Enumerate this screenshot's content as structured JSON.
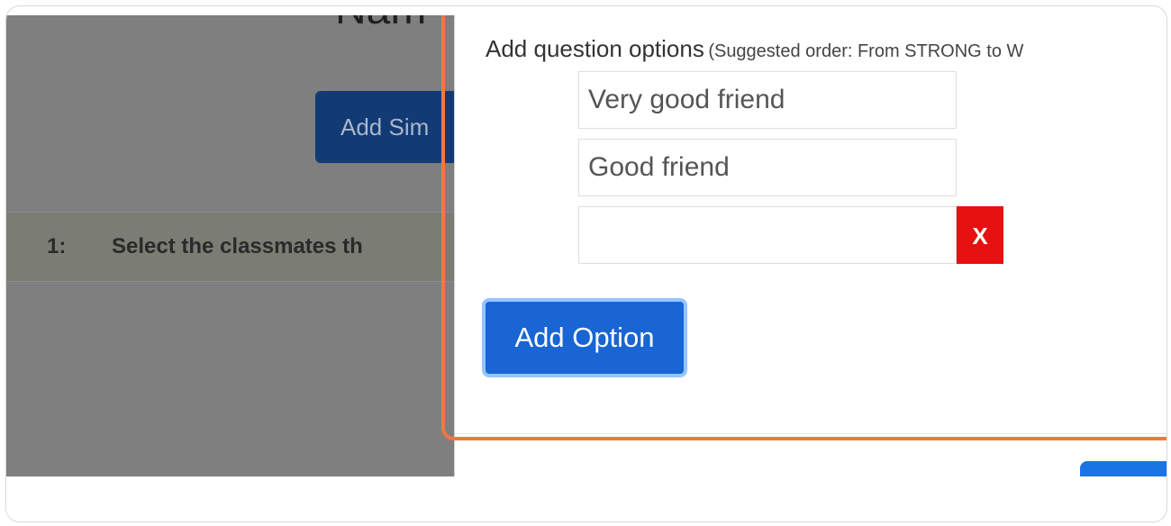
{
  "background": {
    "title_fragment": "Nam",
    "add_button_label": "Add Sim",
    "question_row": {
      "number": "1:",
      "text": "Select the classmates th"
    }
  },
  "modal": {
    "options_heading": "Add question options",
    "options_hint": "(Suggested order: From STRONG to W",
    "options": [
      {
        "value": "Very good friend"
      },
      {
        "value": "Good friend"
      },
      {
        "value": ""
      }
    ],
    "remove_label": "X",
    "add_option_label": "Add Option"
  },
  "colors": {
    "accent": "#1865d3",
    "remove": "#e81111",
    "highlight": "#f47740",
    "overlay": "#7f7f7f"
  }
}
